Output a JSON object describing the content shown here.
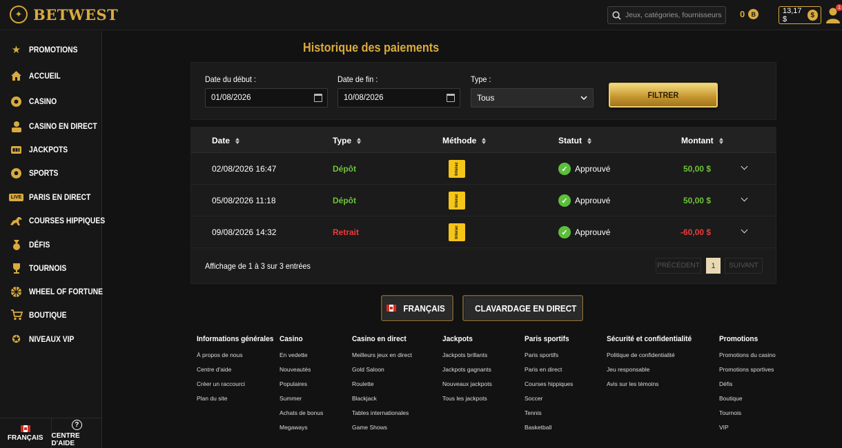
{
  "brand": {
    "name": "BETWEST"
  },
  "search": {
    "placeholder": "Jeux, catégories, fournisseurs"
  },
  "header": {
    "bonus_count": "0",
    "balance": "13,17 $",
    "coin_symbol": "$",
    "notification_count": "1"
  },
  "sidebar": {
    "items": [
      {
        "label": "PROMOTIONS",
        "icon": "star-icon"
      },
      {
        "label": "ACCUEIL",
        "icon": "home-icon"
      },
      {
        "label": "CASINO",
        "icon": "roulette-icon"
      },
      {
        "label": "CASINO EN DIRECT",
        "icon": "dealer-icon"
      },
      {
        "label": "JACKPOTS",
        "icon": "slot-machine-icon"
      },
      {
        "label": "SPORTS",
        "icon": "ball-icon"
      },
      {
        "label": "PARIS EN DIRECT",
        "icon": "live-icon",
        "tag": "LIVE"
      },
      {
        "label": "COURSES HIPPIQUES",
        "icon": "horse-icon"
      },
      {
        "label": "DÉFIS",
        "icon": "medal-icon"
      },
      {
        "label": "TOURNOIS",
        "icon": "trophy-icon"
      },
      {
        "label": "WHEEL OF FORTUNE",
        "icon": "wheel-icon"
      },
      {
        "label": "BOUTIQUE",
        "icon": "cart-icon"
      },
      {
        "label": "NIVEAUX VIP",
        "icon": "vip-star-icon"
      }
    ],
    "bottom": {
      "language": "FRANÇAIS",
      "help": "CENTRE D'AIDE"
    }
  },
  "page": {
    "title": "Historique des paiements"
  },
  "filters": {
    "start_label": "Date du début :",
    "start_value": "01/08/2026",
    "end_label": "Date de fin :",
    "end_value": "10/08/2026",
    "type_label": "Type :",
    "type_value": "Tous",
    "submit": "FILTRER"
  },
  "table": {
    "columns": [
      "Date",
      "Type",
      "Méthode",
      "Statut",
      "Montant"
    ],
    "method_logo": "Interac",
    "rows": [
      {
        "date": "02/08/2026 16:47",
        "type": "Dépôt",
        "kind": "pos",
        "status": "Approuvé",
        "amount": "50,00 $"
      },
      {
        "date": "05/08/2026 11:18",
        "type": "Dépôt",
        "kind": "pos",
        "status": "Approuvé",
        "amount": "50,00 $"
      },
      {
        "date": "09/08/2026 14:32",
        "type": "Retrait",
        "kind": "neg",
        "status": "Approuvé",
        "amount": "-60,00 $"
      }
    ],
    "summary": "Affichage de 1 à 3 sur 3 entrées",
    "pagination": {
      "prev": "PRÉCÉDENT",
      "current": "1",
      "next": "SUIVANT"
    }
  },
  "actions": {
    "language": "FRANÇAIS",
    "chat": "CLAVARDAGE EN DIRECT"
  },
  "footer": {
    "columns": [
      {
        "title": "Informations générales",
        "links": [
          "À propos de nous",
          "Centre d'aide",
          "Créer un raccourci",
          "Plan du site"
        ]
      },
      {
        "title": "Casino",
        "links": [
          "En vedette",
          "Nouveautés",
          "Populaires",
          "Summer",
          "Achats de bonus",
          "Megaways"
        ]
      },
      {
        "title": "Casino en direct",
        "links": [
          "Meilleurs jeux en direct",
          "Gold Saloon",
          "Roulette",
          "Blackjack",
          "Tables internationales",
          "Game Shows"
        ]
      },
      {
        "title": "Jackpots",
        "links": [
          "Jackpots brillants",
          "Jackpots gagnants",
          "Nouveaux jackpots",
          "Tous les jackpots"
        ]
      },
      {
        "title": "Paris sportifs",
        "links": [
          "Paris sportifs",
          "Paris en direct",
          "Courses hippiques",
          "Soccer",
          "Tennis",
          "Basketball"
        ]
      },
      {
        "title": "Sécurité et confidentialité",
        "links": [
          "Politique de confidentialité",
          "Jeu responsable",
          "Avis sur les témoins"
        ]
      },
      {
        "title": "Promotions",
        "links": [
          "Promotions du casino",
          "Promotions sportives",
          "Défis",
          "Boutique",
          "Tournois",
          "VIP"
        ]
      }
    ]
  },
  "colors": {
    "gold": "#d9ab3f",
    "positive": "#6fc23a",
    "negative": "#ee3a3a",
    "background": "#121212"
  }
}
